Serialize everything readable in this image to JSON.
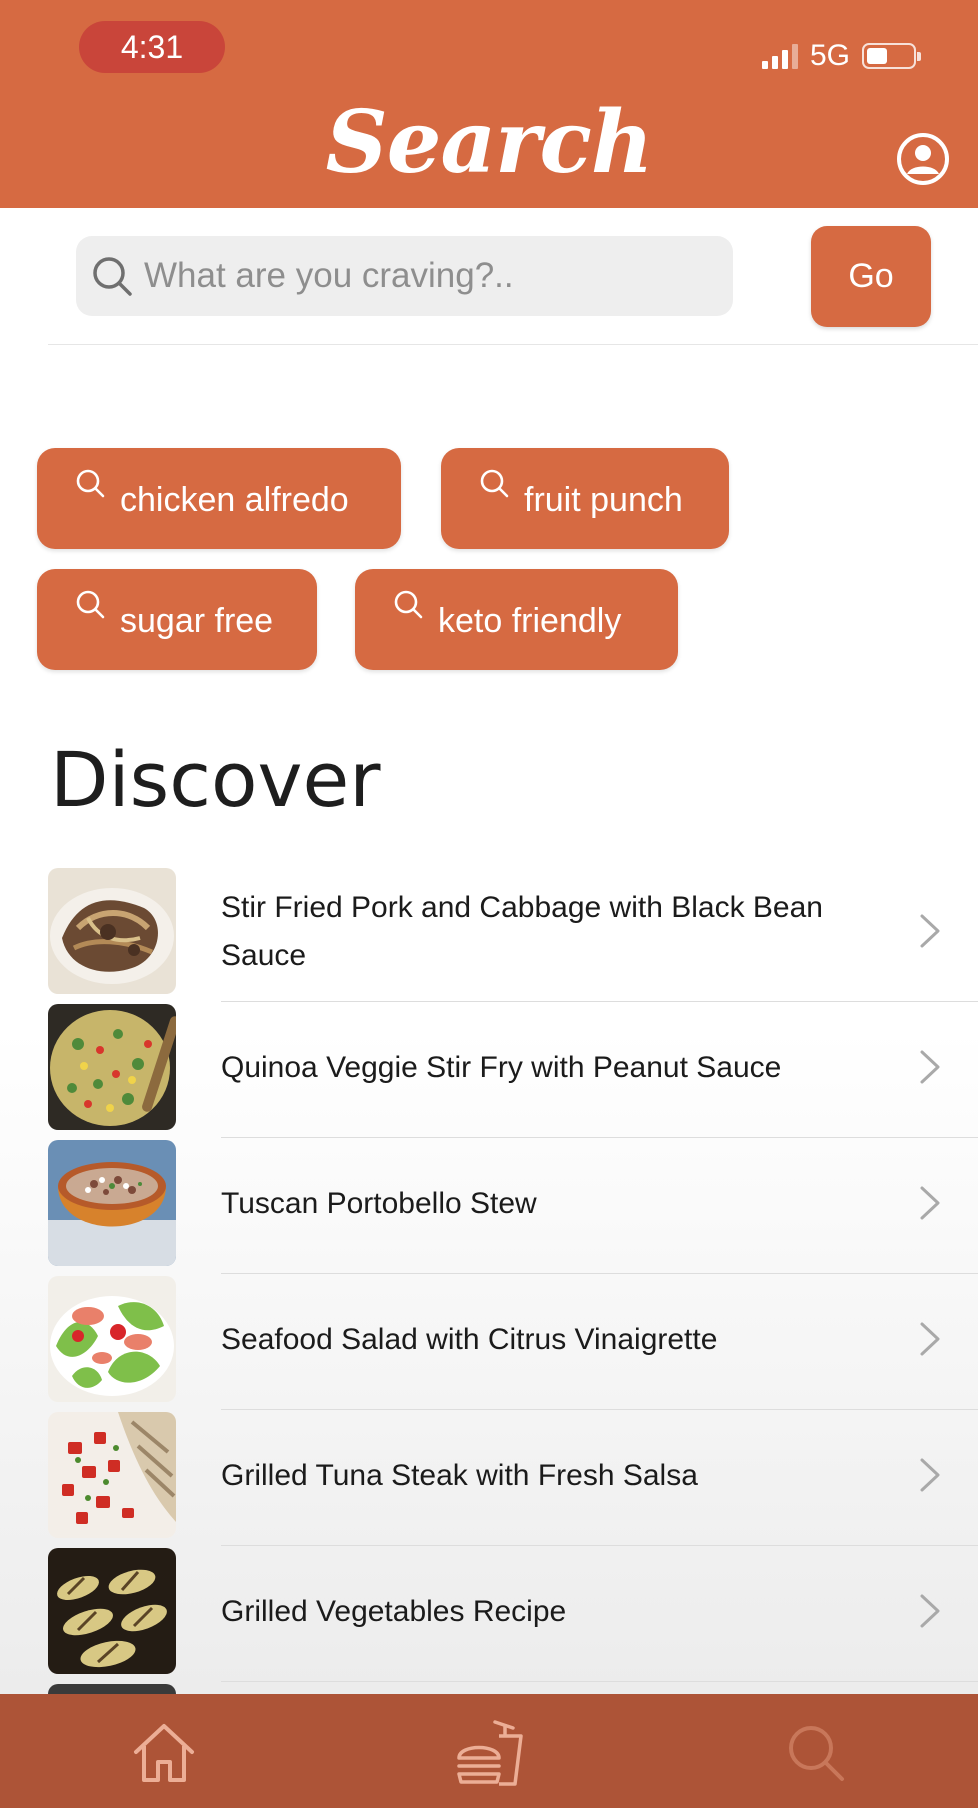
{
  "status_bar": {
    "time": "4:31",
    "network": "5G",
    "battery_level": 0.45
  },
  "header": {
    "title": "Search",
    "profile_icon": "user-circle-icon"
  },
  "search": {
    "placeholder": "What are you craving?..",
    "value": "",
    "go_label": "Go",
    "icon": "search-icon"
  },
  "suggestions": [
    {
      "label": "chicken alfredo"
    },
    {
      "label": "fruit punch"
    },
    {
      "label": "sugar free"
    },
    {
      "label": "keto friendly"
    }
  ],
  "discover": {
    "title": "Discover",
    "items": [
      {
        "title": "Stir Fried Pork and Cabbage with Black Bean Sauce"
      },
      {
        "title": "Quinoa Veggie Stir Fry with Peanut Sauce"
      },
      {
        "title": "Tuscan Portobello Stew"
      },
      {
        "title": "Seafood Salad with Citrus Vinaigrette"
      },
      {
        "title": "Grilled Tuna Steak with Fresh Salsa"
      },
      {
        "title": "Grilled Vegetables Recipe"
      }
    ]
  },
  "tabbar": {
    "tabs": [
      {
        "icon": "home-icon"
      },
      {
        "icon": "fast-food-icon"
      },
      {
        "icon": "search-icon"
      }
    ]
  },
  "colors": {
    "brand": "#d66a42",
    "tabbar": "#ad5437",
    "time_pill": "#c9453a"
  }
}
